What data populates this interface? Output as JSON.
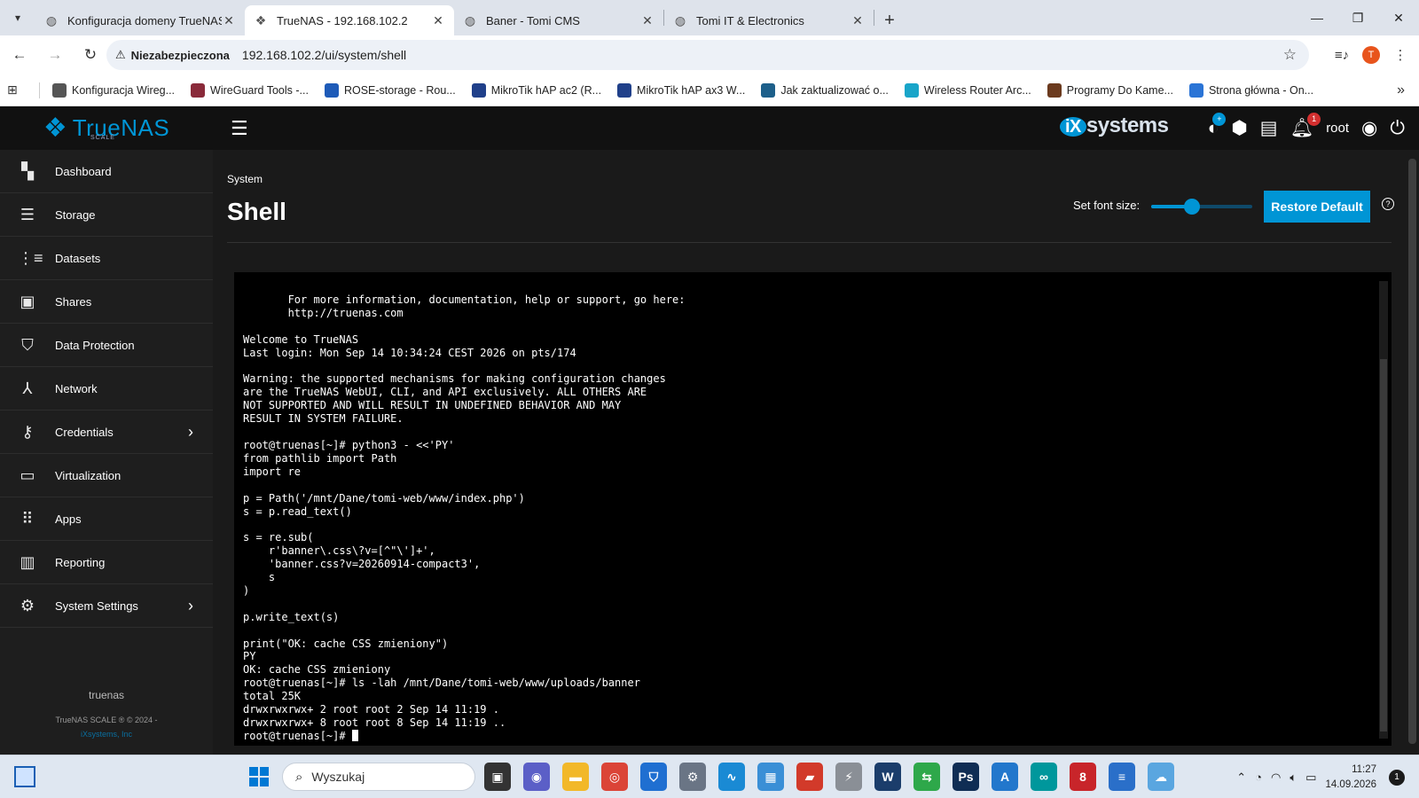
{
  "browser": {
    "tabs": [
      {
        "title": "Konfiguracja domeny TrueNAS",
        "icon": "globe-icon",
        "active": false
      },
      {
        "title": "TrueNAS - 192.168.102.2",
        "icon": "truenas-icon",
        "active": true
      },
      {
        "title": "Baner - Tomi CMS",
        "icon": "globe-icon",
        "active": false
      },
      {
        "title": "Tomi IT & Electronics",
        "icon": "globe-icon",
        "active": false
      }
    ],
    "security_label": "Niezabezpieczona",
    "url": "192.168.102.2/ui/system/shell",
    "profile_initial": "T",
    "bookmarks": [
      {
        "label": "Konfiguracja Wireg...",
        "color": "#555555"
      },
      {
        "label": "WireGuard Tools -...",
        "color": "#8a2a3a"
      },
      {
        "label": "ROSE-storage - Rou...",
        "color": "#1e5bb8"
      },
      {
        "label": "MikroTik hAP ac2 (R...",
        "color": "#20408a"
      },
      {
        "label": "MikroTik hAP ax3 W...",
        "color": "#20408a"
      },
      {
        "label": "Jak zaktualizować o...",
        "color": "#1d5f8a"
      },
      {
        "label": "Wireless Router Arc...",
        "color": "#19a5c9"
      },
      {
        "label": "Programy Do Kame...",
        "color": "#6b3a1e"
      },
      {
        "label": "Strona główna - On...",
        "color": "#2a74d6"
      }
    ]
  },
  "app": {
    "brand": "TrueNAS",
    "brand_sub": "SCALE",
    "vendor": "systems",
    "vendor_i": "iX",
    "user": "root",
    "alerts_count": "1",
    "nav": [
      {
        "label": "Dashboard",
        "icon": "dashboard-icon",
        "chevron": false
      },
      {
        "label": "Storage",
        "icon": "storage-icon",
        "chevron": false
      },
      {
        "label": "Datasets",
        "icon": "datasets-icon",
        "chevron": false
      },
      {
        "label": "Shares",
        "icon": "shares-icon",
        "chevron": false
      },
      {
        "label": "Data Protection",
        "icon": "shield-icon",
        "chevron": false
      },
      {
        "label": "Network",
        "icon": "network-icon",
        "chevron": false
      },
      {
        "label": "Credentials",
        "icon": "key-icon",
        "chevron": true
      },
      {
        "label": "Virtualization",
        "icon": "monitor-icon",
        "chevron": false
      },
      {
        "label": "Apps",
        "icon": "apps-grid-icon",
        "chevron": false
      },
      {
        "label": "Reporting",
        "icon": "chart-icon",
        "chevron": false
      },
      {
        "label": "System Settings",
        "icon": "gear-icon",
        "chevron": true
      }
    ],
    "hostname": "truenas",
    "copyright": "TrueNAS SCALE ® © 2024 -",
    "company_link": "iXsystems, Inc"
  },
  "page": {
    "breadcrumb": "System",
    "title": "Shell",
    "font_size_label": "Set font size:",
    "font_size_fraction": 0.4,
    "restore_label": "Restore Default",
    "help": "?"
  },
  "terminal": {
    "lines": [
      "       For more information, documentation, help or support, go here:",
      "       http://truenas.com",
      "",
      "Welcome to TrueNAS",
      "Last login: Mon Sep 14 10:34:24 CEST 2026 on pts/174",
      "",
      "Warning: the supported mechanisms for making configuration changes",
      "are the TrueNAS WebUI, CLI, and API exclusively. ALL OTHERS ARE",
      "NOT SUPPORTED AND WILL RESULT IN UNDEFINED BEHAVIOR AND MAY",
      "RESULT IN SYSTEM FAILURE.",
      "",
      "root@truenas[~]# python3 - <<'PY'",
      "from pathlib import Path",
      "import re",
      "",
      "p = Path('/mnt/Dane/tomi-web/www/index.php')",
      "s = p.read_text()",
      "",
      "s = re.sub(",
      "    r'banner\\.css\\?v=[^\"\\']+',",
      "    'banner.css?v=20260914-compact3',",
      "    s",
      ")",
      "",
      "p.write_text(s)",
      "",
      "print(\"OK: cache CSS zmieniony\")",
      "PY",
      "OK: cache CSS zmieniony",
      "root@truenas[~]# ls -lah /mnt/Dane/tomi-web/www/uploads/banner",
      "total 25K",
      "drwxrwxrwx+ 2 root root 2 Sep 14 11:19 .",
      "drwxrwxrwx+ 8 root root 8 Sep 14 11:19 .."
    ],
    "prompt": "root@truenas[~]# "
  },
  "taskbar": {
    "search_placeholder": "Wyszukaj",
    "time": "11:27",
    "date": "14.09.2026",
    "notifications": "1",
    "apps": [
      {
        "name": "task-view-icon",
        "color": "#333333",
        "glyph": "▣"
      },
      {
        "name": "meet-icon",
        "color": "#5b5fc7",
        "glyph": "◉"
      },
      {
        "name": "file-explorer-icon",
        "color": "#f2b829",
        "glyph": "▬"
      },
      {
        "name": "chrome-icon",
        "color": "#db4437",
        "glyph": "◎"
      },
      {
        "name": "defender-icon",
        "color": "#1f6fd1",
        "glyph": "⛉"
      },
      {
        "name": "settings-icon",
        "color": "#6a7585",
        "glyph": "⚙"
      },
      {
        "name": "edge-icon",
        "color": "#1a8ad4",
        "glyph": "∿"
      },
      {
        "name": "control-panel-icon",
        "color": "#3a8fd6",
        "glyph": "▦"
      },
      {
        "name": "car-app-icon",
        "color": "#d23a2a",
        "glyph": "▰"
      },
      {
        "name": "opel-icon",
        "color": "#8a8f96",
        "glyph": "⚡"
      },
      {
        "name": "winbox-icon",
        "color": "#1b3d6b",
        "glyph": "W"
      },
      {
        "name": "sync-app-icon",
        "color": "#2ea84a",
        "glyph": "⇆"
      },
      {
        "name": "photoshop-icon",
        "color": "#0f2d54",
        "glyph": "Ps"
      },
      {
        "name": "app-store-icon",
        "color": "#2277cc",
        "glyph": "A"
      },
      {
        "name": "arduino-icon",
        "color": "#00979c",
        "glyph": "∞"
      },
      {
        "name": "red-app-icon",
        "color": "#c8252a",
        "glyph": "8"
      },
      {
        "name": "notepad-icon",
        "color": "#2a6fc9",
        "glyph": "≡"
      },
      {
        "name": "weather-icon",
        "color": "#5aa6e0",
        "glyph": "☁"
      }
    ]
  }
}
